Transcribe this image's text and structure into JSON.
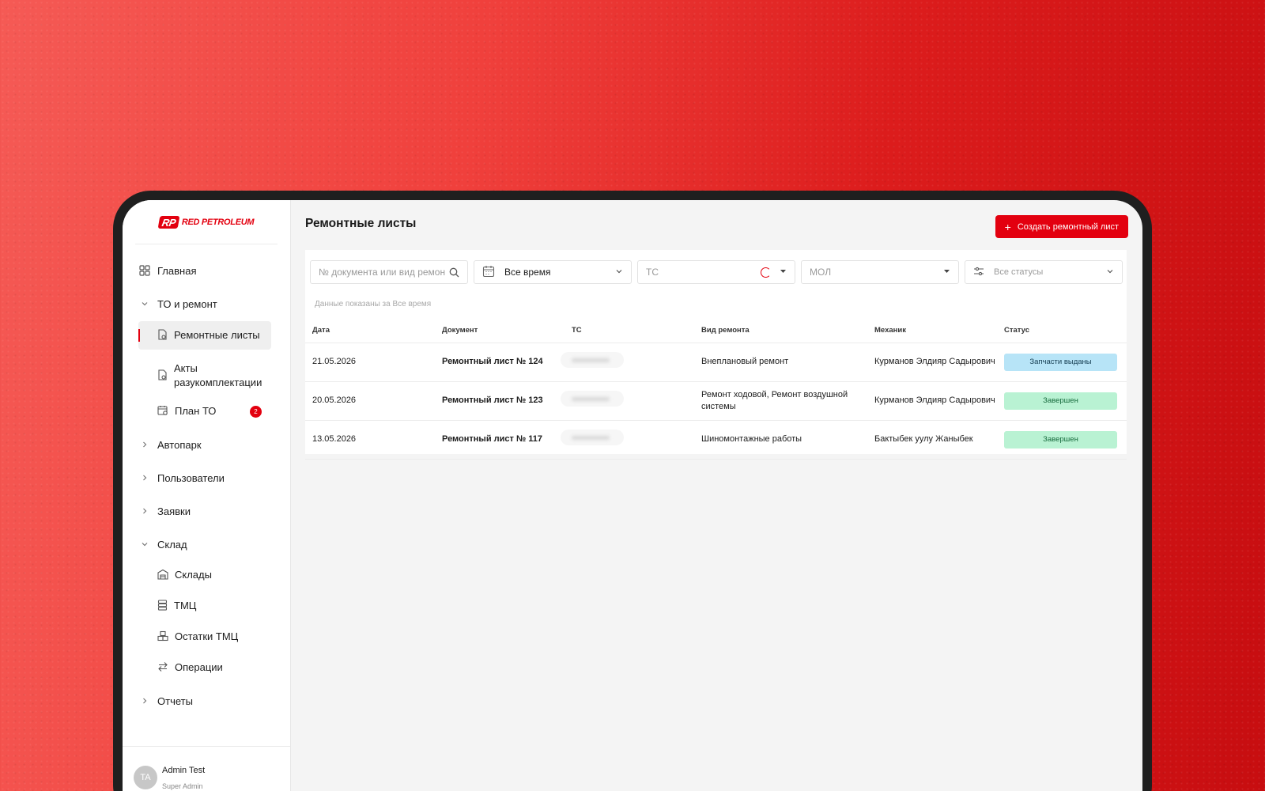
{
  "brand": {
    "logo_mark": "RP",
    "logo_text": "RED PETROLEUM",
    "accent": "#e3000f"
  },
  "sidebar": {
    "home": "Главная",
    "to_group": "ТО и ремонт",
    "to_items": [
      {
        "label": "Ремонтные листы",
        "active": true,
        "icon": "document-gear-icon"
      },
      {
        "label": "Акты разукомплектации",
        "icon": "document-gear-icon"
      },
      {
        "label": "План ТО",
        "badge": "2",
        "icon": "calendar-gear-icon"
      }
    ],
    "groups_collapsed": [
      "Автопарк",
      "Пользователи",
      "Заявки"
    ],
    "warehouse_group": "Склад",
    "warehouse_items": [
      {
        "label": "Склады",
        "icon": "warehouse-icon"
      },
      {
        "label": "ТМЦ",
        "icon": "stack-icon"
      },
      {
        "label": "Остатки ТМЦ",
        "icon": "boxes-icon"
      },
      {
        "label": "Операции",
        "icon": "swap-icon"
      }
    ],
    "reports": "Отчеты",
    "user": {
      "initials": "TA",
      "name": "Admin Test",
      "role": "Super Admin"
    }
  },
  "main": {
    "title": "Ремонтные листы",
    "create_button": "Создать ремонтный лист",
    "filters": {
      "search_placeholder": "№ документа или вид ремонта",
      "period": "Все время",
      "vehicle_placeholder": "ТС",
      "mol_placeholder": "МОЛ",
      "status_placeholder": "Все статусы"
    },
    "data_note": "Данные показаны за Все время",
    "table": {
      "columns": [
        "Дата",
        "Документ",
        "ТС",
        "Вид ремонта",
        "Механик",
        "Статус"
      ],
      "rows": [
        {
          "date": "21.05.2026",
          "document": "Ремонтный лист № 124",
          "repair_type": "Внеплановый ремонт",
          "mechanic": "Курманов Элдияр Садырович",
          "status": "Запчасти выданы",
          "status_color": "#b7e4f7"
        },
        {
          "date": "20.05.2026",
          "document": "Ремонтный лист № 123",
          "repair_type": "Ремонт ходовой, Ремонт воздушной системы",
          "mechanic": "Курманов Элдияр Садырович",
          "status": "Завершен",
          "status_color": "#b9f2d3"
        },
        {
          "date": "13.05.2026",
          "document": "Ремонтный лист № 117",
          "repair_type": "Шиномонтажные работы",
          "mechanic": "Бактыбек уулу Жаныбек",
          "status": "Завершен",
          "status_color": "#b9f2d3"
        }
      ]
    }
  }
}
